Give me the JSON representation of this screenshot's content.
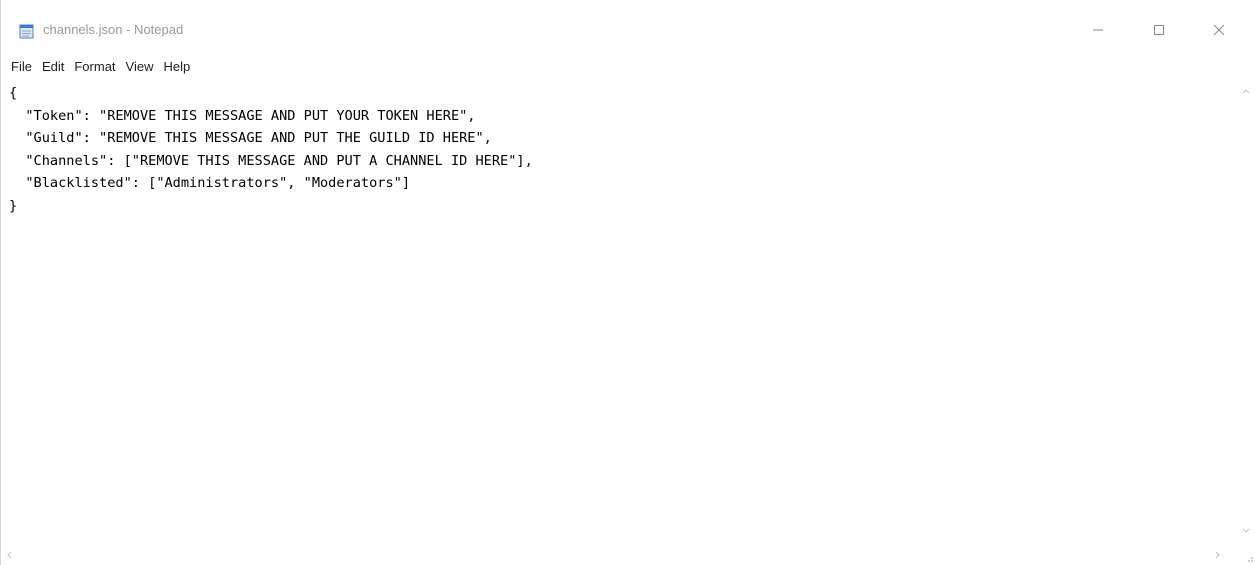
{
  "window": {
    "title": "channels.json - Notepad",
    "controls": {
      "minimize_icon": "minimize-icon",
      "maximize_icon": "maximize-icon",
      "close_icon": "close-icon"
    }
  },
  "menu": {
    "items": [
      {
        "label": "File"
      },
      {
        "label": "Edit"
      },
      {
        "label": "Format"
      },
      {
        "label": "View"
      },
      {
        "label": "Help"
      }
    ]
  },
  "editor": {
    "lines": [
      "{",
      "  \"Token\": \"REMOVE THIS MESSAGE AND PUT YOUR TOKEN HERE\",",
      "  \"Guild\": \"REMOVE THIS MESSAGE AND PUT THE GUILD ID HERE\",",
      "  \"Channels\": [\"REMOVE THIS MESSAGE AND PUT A CHANNEL ID HERE\"],",
      "  \"Blacklisted\": [\"Administrators\", \"Moderators\"]",
      "}"
    ]
  },
  "colors": {
    "title_text": "#9a9a9a",
    "menu_text": "#222222",
    "editor_text": "#000000",
    "background": "#ffffff"
  }
}
